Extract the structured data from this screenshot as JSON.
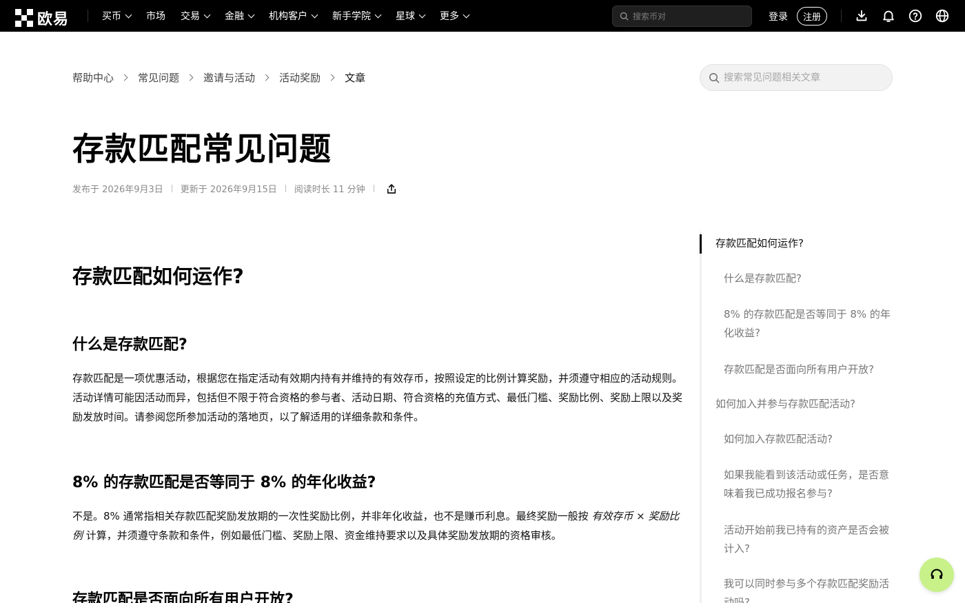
{
  "nav": {
    "logo_text": "欧易",
    "items": [
      {
        "label": "买币",
        "dropdown": true
      },
      {
        "label": "市场",
        "dropdown": false
      },
      {
        "label": "交易",
        "dropdown": true
      },
      {
        "label": "金融",
        "dropdown": true
      },
      {
        "label": "机构客户",
        "dropdown": true
      },
      {
        "label": "新手学院",
        "dropdown": true
      },
      {
        "label": "星球",
        "dropdown": true
      },
      {
        "label": "更多",
        "dropdown": true
      }
    ],
    "search_placeholder": "搜索币对",
    "login_label": "登录",
    "register_label": "注册",
    "icons": [
      "download-icon",
      "bell-icon",
      "help-icon",
      "globe-icon"
    ]
  },
  "breadcrumb": [
    "帮助中心",
    "常见问题",
    "邀请与活动",
    "活动奖励",
    "文章"
  ],
  "faq_search_placeholder": "搜索常见问题相关文章",
  "article": {
    "title": "存款匹配常见问题",
    "published": "发布于 2026年9月3日",
    "updated": "更新于 2026年9月15日",
    "read_time": "阅读时长 11 分钟",
    "section1_title": "存款匹配如何运作?",
    "q1_title": "什么是存款匹配?",
    "q1_body": "存款匹配是一项优惠活动，根据您在指定活动有效期内持有并维持的有效存币，按照设定的比例计算奖励，并须遵守相应的活动规则。活动详情可能因活动而异，包括但不限于符合资格的参与者、活动日期、符合资格的充值方式、最低门槛、奖励比例、奖励上限以及奖励发放时间。请参阅您所参加活动的落地页，以了解适用的详细条款和条件。",
    "q2_title": "8% 的存款匹配是否等同于 8% 的年化收益?",
    "q2_body_a": "不是。8% 通常指相关存款匹配奖励发放期的一次性奖励比例，并非年化收益，也不是赚币利息。最终奖励一般按 ",
    "q2_body_em": "有效存币 × 奖励比例",
    "q2_body_b": " 计算，并须遵守条款和条件，例如最低门槛、奖励上限、资金维持要求以及具体奖励发放期的资格审核。",
    "q3_title": "存款匹配是否面向所有用户开放?"
  },
  "toc": [
    {
      "label": "存款匹配如何运作?",
      "level": 1,
      "active": true
    },
    {
      "label": "什么是存款匹配?",
      "level": 2,
      "active": false
    },
    {
      "label": "8% 的存款匹配是否等同于 8% 的年化收益?",
      "level": 2,
      "active": false
    },
    {
      "label": "存款匹配是否面向所有用户开放?",
      "level": 2,
      "active": false
    },
    {
      "label": "如何加入并参与存款匹配活动?",
      "level": 1,
      "active": false
    },
    {
      "label": "如何加入存款匹配活动?",
      "level": 2,
      "active": false
    },
    {
      "label": "如果我能看到该活动或任务，是否意味着我已成功报名参与?",
      "level": 2,
      "active": false
    },
    {
      "label": "活动开始前我已持有的资产是否会被计入?",
      "level": 2,
      "active": false
    },
    {
      "label": "我可以同时参与多个存款匹配奖励活动吗?",
      "level": 2,
      "active": false
    }
  ],
  "colors": {
    "accent": "#000000",
    "support_button": "#c8f18a"
  }
}
